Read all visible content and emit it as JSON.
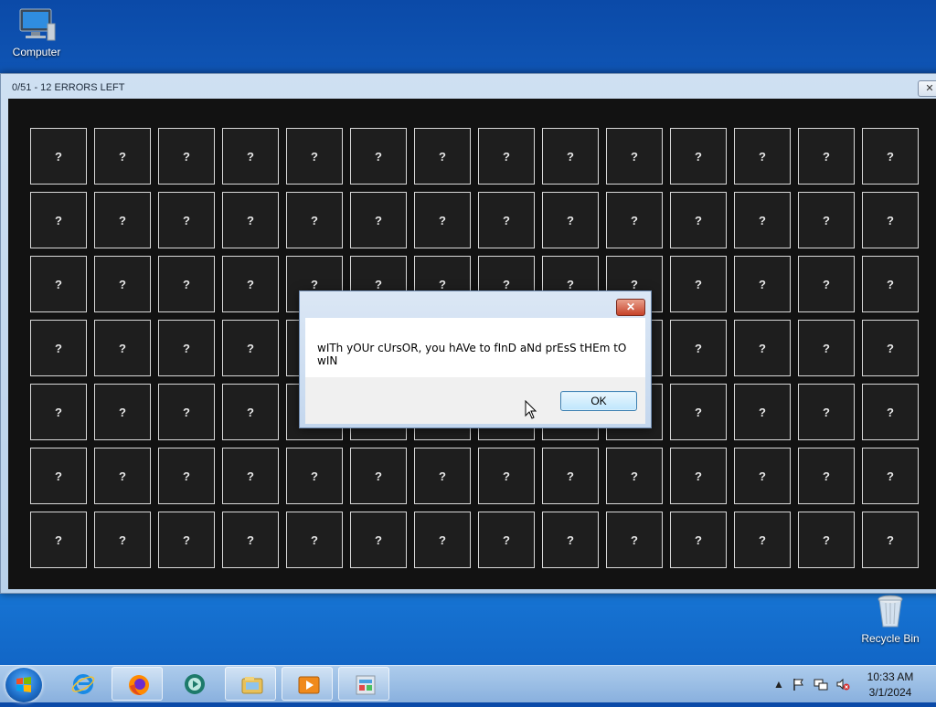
{
  "desktop": {
    "computer_label": "Computer",
    "recycle_label": "Recycle Bin"
  },
  "game_window": {
    "title": "0/51 - 12 ERRORS LEFT",
    "close_label": "✕",
    "tile_label": "?",
    "rows": 7,
    "cols": 14
  },
  "dialog": {
    "close_label": "✕",
    "message": "wITh yOUr cUrsOR, you hAVe to fInD aNd prEsS tHEm tO wIN",
    "ok_label": "OK"
  },
  "taskbar": {
    "items": [
      "start-button",
      "internet-explorer-icon",
      "firefox-icon",
      "media-player-icon",
      "file-explorer-icon",
      "video-app-icon",
      "game-app-icon"
    ],
    "tray_arrow": "▲",
    "time": "10:33 AM",
    "date": "3/1/2024"
  }
}
